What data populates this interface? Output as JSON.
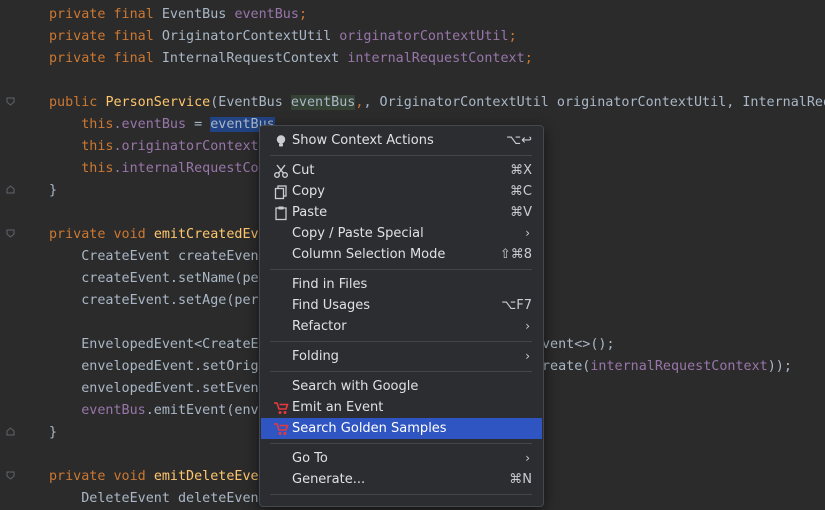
{
  "code": {
    "line1": {
      "kw1": "private",
      "kw2": "final",
      "type": "EventBus",
      "field": "eventBus",
      "end": ";"
    },
    "line2": {
      "kw1": "private",
      "kw2": "final",
      "type": "OriginatorContextUtil",
      "field": "originatorContextUtil",
      "end": ";"
    },
    "line3": {
      "kw1": "private",
      "kw2": "final",
      "type": "InternalRequestContext",
      "field": "internalRequestContext",
      "end": ";"
    },
    "line5": {
      "kw": "public",
      "name": "PersonService",
      "open": "(EventBus ",
      "param": "eventBus",
      "rest": ", OriginatorContextUtil originatorContextUtil, InternalRequest"
    },
    "line6": {
      "this": "this",
      "field": ".eventBus",
      "eq": " = ",
      "sel": "eventBus"
    },
    "line7": {
      "this": "this",
      "field": ".originatorContextU"
    },
    "line8": {
      "this": "this",
      "field": ".internalRequestCon"
    },
    "line9": "}",
    "line11": {
      "kw1": "private",
      "kw2": "void",
      "name": "emitCreatedEve"
    },
    "line12": "CreateEvent createEvent",
    "line13": "createEvent.setName(per",
    "line14": "createEvent.setAge(pers",
    "line16": {
      "left": "EnvelopedEvent<CreateEv",
      "right": "vent<>();"
    },
    "line17": {
      "left": "envelopedEvent.setOrigi",
      "right": "reate(",
      "field": "internalRequestContext",
      "end": "));"
    },
    "line18": "envelopedEvent.setEvent",
    "line19": {
      "field": "eventBus",
      "rest": ".emitEvent(enve"
    },
    "line20": "}",
    "line22": {
      "kw1": "private",
      "kw2": "void",
      "name": "emitDeleteEven"
    },
    "line23": "DeleteEvent deleteEvent"
  },
  "context_menu": {
    "show_context_actions": {
      "label": "Show Context Actions",
      "shortcut": "⌥↩"
    },
    "cut": {
      "label": "Cut",
      "shortcut": "⌘X"
    },
    "copy": {
      "label": "Copy",
      "shortcut": "⌘C"
    },
    "paste": {
      "label": "Paste",
      "shortcut": "⌘V"
    },
    "copy_paste_special": {
      "label": "Copy / Paste Special"
    },
    "column_selection_mode": {
      "label": "Column Selection Mode",
      "shortcut": "⇧⌘8"
    },
    "find_in_files": {
      "label": "Find in Files"
    },
    "find_usages": {
      "label": "Find Usages",
      "shortcut": "⌥F7"
    },
    "refactor": {
      "label": "Refactor"
    },
    "folding": {
      "label": "Folding"
    },
    "search_with_google": {
      "label": "Search with Google"
    },
    "emit_an_event": {
      "label": "Emit an Event"
    },
    "search_golden_samples": {
      "label": "Search Golden Samples"
    },
    "go_to": {
      "label": "Go To"
    },
    "generate": {
      "label": "Generate...",
      "shortcut": "⌘N"
    }
  },
  "colors": {
    "editor_bg": "#2b2b2b",
    "keyword": "#cc7832",
    "field": "#9876aa",
    "function": "#ffc66d",
    "menu_bg": "#2b2d30",
    "menu_active": "#2e55c1",
    "plugin_icon": "#e5393e"
  },
  "icons": [
    "bulb-icon",
    "scissors-icon",
    "copy-icon",
    "clipboard-icon",
    "plugin-icon",
    "chevron-right-icon",
    "fold-marker-icon"
  ]
}
